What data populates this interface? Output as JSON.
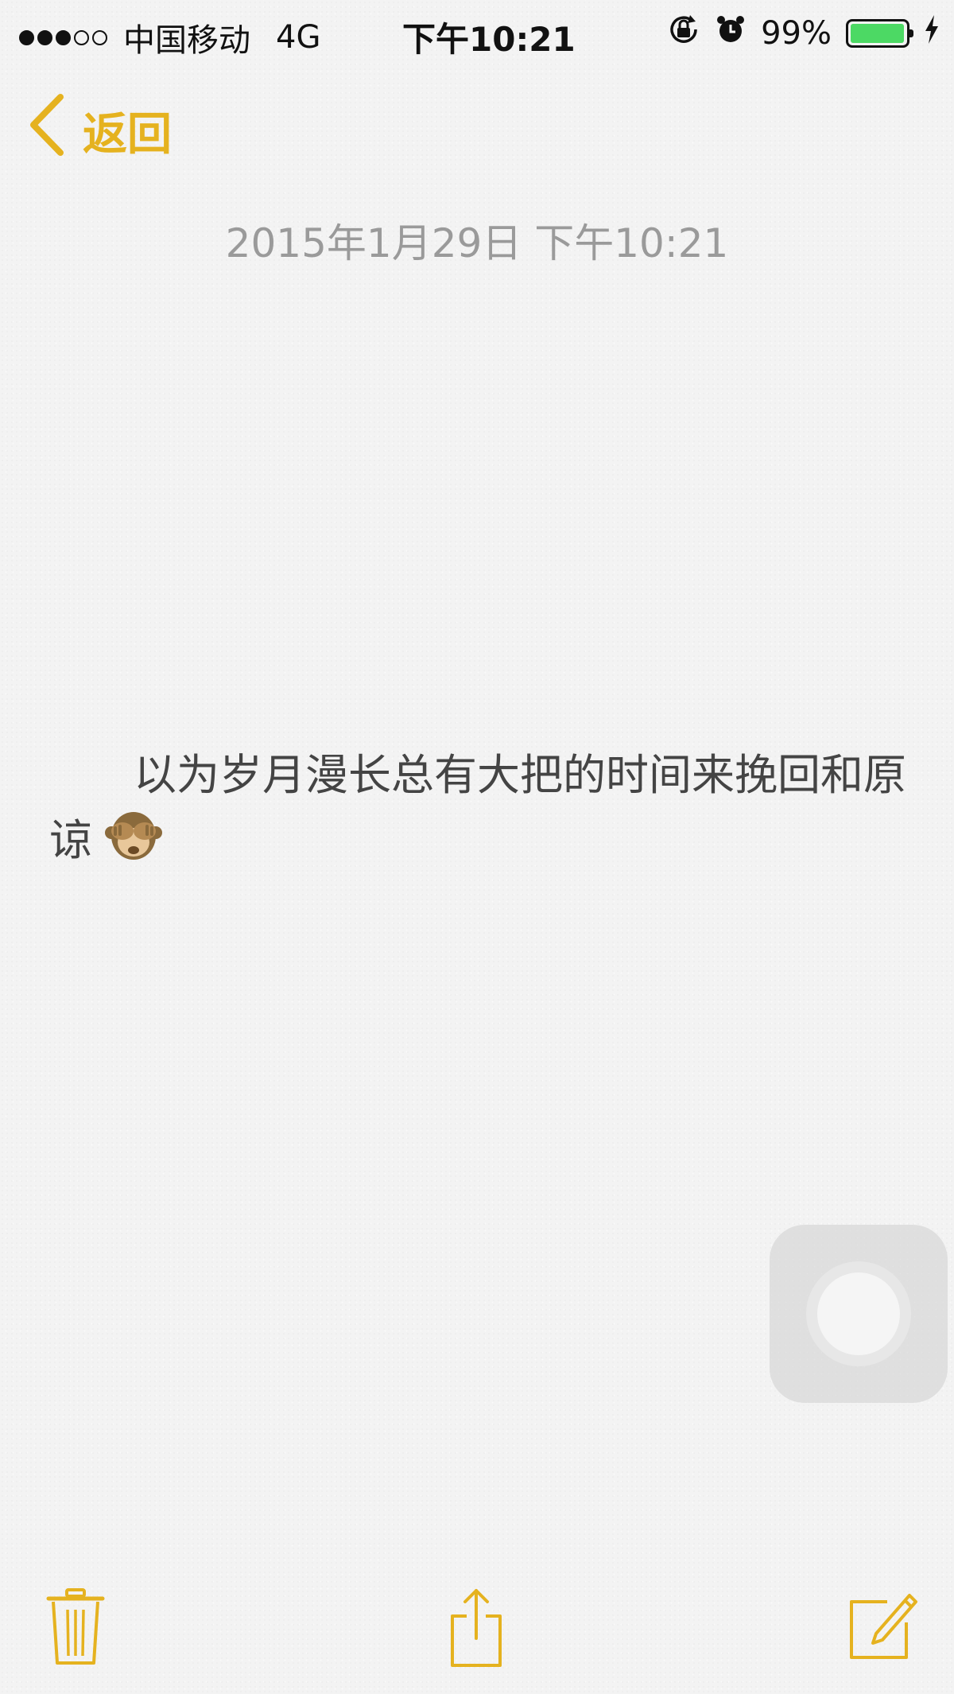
{
  "status_bar": {
    "carrier": "中国移动",
    "network": "4G",
    "time": "下午10:21",
    "battery_percent_text": "99%",
    "battery_level": 0.99,
    "signal_bars_filled": 3,
    "signal_bars_total": 5,
    "icons": [
      "orientation-lock-icon",
      "alarm-icon",
      "charging-bolt-icon"
    ],
    "battery_color": "#4cd964"
  },
  "nav": {
    "back_label": "返回",
    "accent_color": "#e5b21f"
  },
  "note": {
    "date": "2015年1月29日 下午10:21",
    "body": "以为岁月漫长总有大把的时间来挽回和原谅",
    "emoji_icon": "see-no-evil-monkey-icon"
  },
  "toolbar": {
    "icons": [
      "trash-icon",
      "share-icon",
      "compose-icon"
    ]
  }
}
